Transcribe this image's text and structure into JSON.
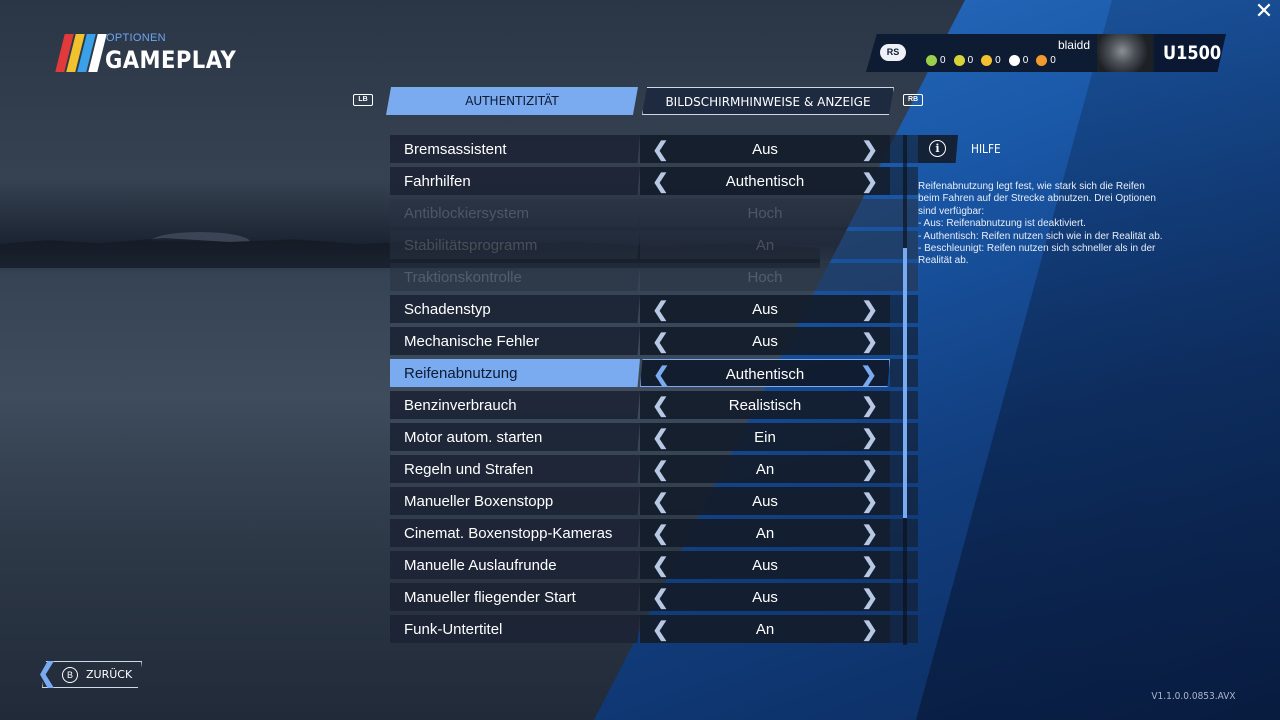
{
  "header": {
    "section_label": "OPTIONEN",
    "title": "GAMEPLAY",
    "logo_colors": [
      "#e23a3a",
      "#f2c12e",
      "#3aa0e8",
      "#ffffff"
    ]
  },
  "profile": {
    "badge": "RS",
    "username": "blaidd",
    "rating": "U1500",
    "stats": [
      {
        "icon": "laurel-icon",
        "value": "0",
        "color": "#9bd04a"
      },
      {
        "icon": "trophy-icon",
        "value": "0",
        "color": "#d8d23a"
      },
      {
        "icon": "medal-icon",
        "value": "0",
        "color": "#f2c12e"
      },
      {
        "icon": "helmet-icon",
        "value": "0",
        "color": "#ffffff"
      },
      {
        "icon": "wheel-icon",
        "value": "0",
        "color": "#f29a2e"
      }
    ]
  },
  "tabs": {
    "left_bumper": "LB",
    "right_bumper": "RB",
    "items": [
      {
        "label": "AUTHENTIZITÄT",
        "active": true
      },
      {
        "label": "BILDSCHIRMHINWEISE & ANZEIGE",
        "active": false
      }
    ]
  },
  "settings": [
    {
      "label": "Bremsassistent",
      "value": "Aus",
      "disabled": false,
      "selected": false
    },
    {
      "label": "Fahrhilfen",
      "value": "Authentisch",
      "disabled": false,
      "selected": false
    },
    {
      "label": "Antiblockiersystem",
      "value": "Hoch",
      "disabled": true,
      "selected": false
    },
    {
      "label": "Stabilitätsprogramm",
      "value": "An",
      "disabled": true,
      "selected": false
    },
    {
      "label": "Traktionskontrolle",
      "value": "Hoch",
      "disabled": true,
      "selected": false
    },
    {
      "label": "Schadenstyp",
      "value": "Aus",
      "disabled": false,
      "selected": false
    },
    {
      "label": "Mechanische Fehler",
      "value": "Aus",
      "disabled": false,
      "selected": false
    },
    {
      "label": "Reifenabnutzung",
      "value": "Authentisch",
      "disabled": false,
      "selected": true
    },
    {
      "label": "Benzinverbrauch",
      "value": "Realistisch",
      "disabled": false,
      "selected": false
    },
    {
      "label": "Motor autom. starten",
      "value": "Ein",
      "disabled": false,
      "selected": false
    },
    {
      "label": "Regeln und Strafen",
      "value": "An",
      "disabled": false,
      "selected": false
    },
    {
      "label": "Manueller Boxenstopp",
      "value": "Aus",
      "disabled": false,
      "selected": false
    },
    {
      "label": "Cinemat. Boxenstopp-Kameras",
      "value": "An",
      "disabled": false,
      "selected": false
    },
    {
      "label": "Manuelle Auslaufrunde",
      "value": "Aus",
      "disabled": false,
      "selected": false
    },
    {
      "label": "Manueller fliegender Start",
      "value": "Aus",
      "disabled": false,
      "selected": false
    },
    {
      "label": "Funk-Untertitel",
      "value": "An",
      "disabled": false,
      "selected": false
    }
  ],
  "help": {
    "title": "HILFE",
    "text": "Reifenabnutzung legt fest, wie stark sich die Reifen beim Fahren auf der Strecke abnutzen. Drei Optionen sind verfügbar:\n- Aus: Reifenabnutzung ist deaktiviert.\n- Authentisch: Reifen nutzen sich wie in der Realität ab.\n- Beschleunigt: Reifen nutzen sich schneller als in der Realität ab."
  },
  "footer": {
    "back_button_glyph": "B",
    "back_label": "ZURÜCK",
    "version": "V1.1.0.0.0853.AVX"
  },
  "colors": {
    "accent": "#7aaaf0",
    "panel": "#1c2434"
  }
}
